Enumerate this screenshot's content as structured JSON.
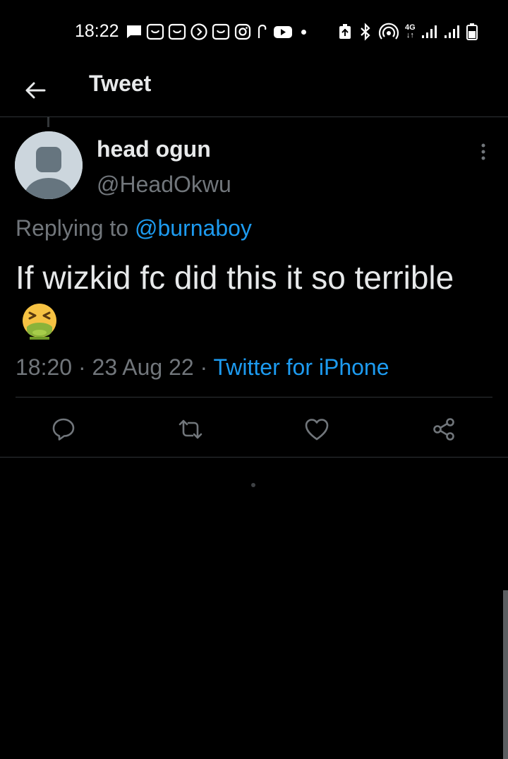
{
  "status_bar": {
    "time": "18:22",
    "notification_icons": [
      "message-icon",
      "app-icon",
      "app-icon",
      "play-circle-icon",
      "app-icon",
      "instagram-icon",
      "p-icon",
      "youtube-icon",
      "dot-icon"
    ],
    "system_icons": [
      "battery-saver-icon",
      "bluetooth-icon",
      "hotspot-icon",
      "network-4g-icon",
      "signal-icon",
      "signal-icon",
      "battery-icon"
    ],
    "network_label": "4G"
  },
  "header": {
    "title": "Tweet"
  },
  "tweet": {
    "author": {
      "display_name": "head ogun",
      "handle": "@HeadOkwu"
    },
    "replying_prefix": "Replying to ",
    "replying_to": "@burnaboy",
    "text": "If wizkid fc did this it so terrible",
    "emoji": "vomiting-face",
    "time": "18:20",
    "separator": " · ",
    "date": "23 Aug 22",
    "source": "Twitter for iPhone"
  },
  "actions": [
    "reply-icon",
    "retweet-icon",
    "like-icon",
    "share-icon"
  ],
  "colors": {
    "background": "#000000",
    "text": "#e7e9ea",
    "secondary": "#71767b",
    "accent": "#1d9bf0",
    "divider": "#2f3336",
    "avatar_bg": "#ccd6dd",
    "avatar_fg": "#66757f"
  }
}
